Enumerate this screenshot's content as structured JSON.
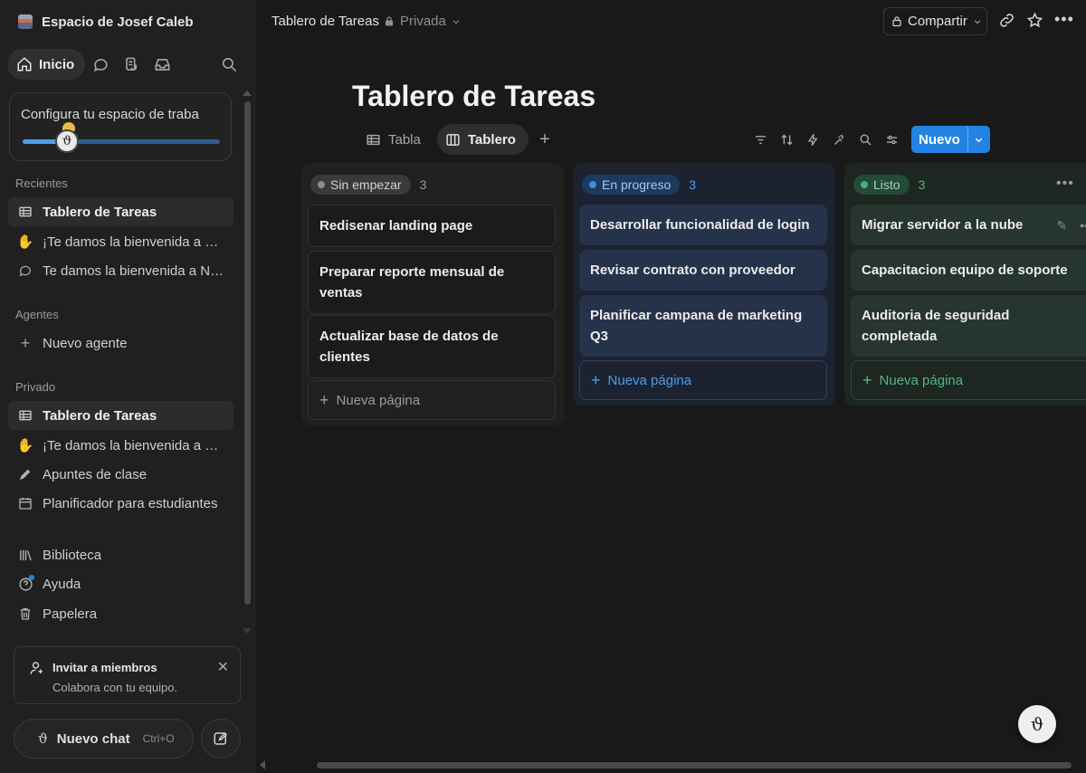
{
  "workspace": {
    "name": "Espacio de Josef Caleb"
  },
  "topnav": {
    "home_label": "Inicio"
  },
  "setup": {
    "title": "Configura tu espacio de traba",
    "progress_fraction": 0.23
  },
  "sidebar": {
    "recents_label": "Recientes",
    "recents": [
      {
        "label": "Tablero de Tareas",
        "icon": "table-icon",
        "active": true
      },
      {
        "label": "¡Te damos la bienvenida a N...",
        "icon": "wave-emoji-icon"
      },
      {
        "label": "Te damos la bienvenida a No...",
        "icon": "chat-bubble-icon"
      }
    ],
    "agents_label": "Agentes",
    "new_agent": "Nuevo agente",
    "private_label": "Privado",
    "private": [
      {
        "label": "Tablero de Tareas",
        "icon": "table-icon",
        "active": true
      },
      {
        "label": "¡Te damos la bienvenida a N...",
        "icon": "wave-emoji-icon"
      },
      {
        "label": "Apuntes de clase",
        "icon": "pencil-icon"
      },
      {
        "label": "Planificador para estudiantes",
        "icon": "calendar-icon"
      }
    ],
    "bottom": [
      {
        "label": "Biblioteca",
        "icon": "library-icon"
      },
      {
        "label": "Ayuda",
        "icon": "help-icon"
      },
      {
        "label": "Papelera",
        "icon": "trash-icon"
      }
    ]
  },
  "invite": {
    "title": "Invitar a miembros",
    "subtitle": "Colabora con tu equipo."
  },
  "new_chat": {
    "label": "Nuevo chat",
    "shortcut": "Ctrl+O"
  },
  "topbar": {
    "breadcrumb": "Tablero de Tareas",
    "privacy": "Privada",
    "share": "Compartir"
  },
  "page": {
    "title": "Tablero de Tareas"
  },
  "views": {
    "tabs": [
      {
        "label": "Tabla"
      },
      {
        "label": "Tablero"
      }
    ]
  },
  "toolbar": {
    "new_label": "Nuevo"
  },
  "board": {
    "columns": [
      {
        "status": "Sin empezar",
        "count": "3",
        "color": "#8d8d8d",
        "cards": [
          "Redisenar landing page",
          "Preparar reporte mensual de ventas",
          "Actualizar base de datos de clientes"
        ],
        "add_label": "Nueva página"
      },
      {
        "status": "En progreso",
        "count": "3",
        "color": "#3a8ee6",
        "cards": [
          "Desarrollar funcionalidad de login",
          "Revisar contrato con proveedor",
          "Planificar campana de marketing Q3"
        ],
        "add_label": "Nueva página"
      },
      {
        "status": "Listo",
        "count": "3",
        "color": "#4caf7d",
        "cards": [
          "Migrar servidor a la nube",
          "Capacitacion equipo de soporte",
          "Auditoria de seguridad completada"
        ],
        "add_label": "Nueva página"
      }
    ]
  },
  "colors": {
    "accent": "#2383e2",
    "background": "#191919",
    "sidebar": "#202020"
  }
}
